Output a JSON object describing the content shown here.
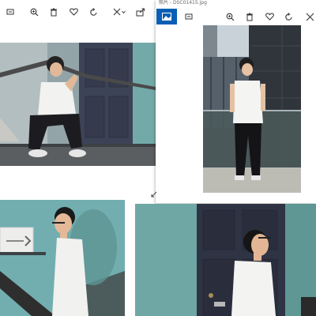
{
  "window_right": {
    "title": "照片 - DSC01415.jpg"
  },
  "colors": {
    "accent": "#0a5fb4",
    "teal_wall": "#6fa7a4",
    "dark_door": "#3a4152",
    "glass_tower": "#3d464f"
  },
  "toolbar_left": {
    "icons": [
      "slideshow-icon",
      "zoom-icon",
      "delete-icon",
      "heart-icon",
      "rotate-icon",
      "edit-icon",
      "share-icon"
    ]
  },
  "toolbar_right": {
    "icons": [
      "photos-home-icon",
      "slideshow-icon",
      "zoom-icon",
      "delete-icon",
      "heart-icon",
      "rotate-icon",
      "edit-icon"
    ]
  }
}
